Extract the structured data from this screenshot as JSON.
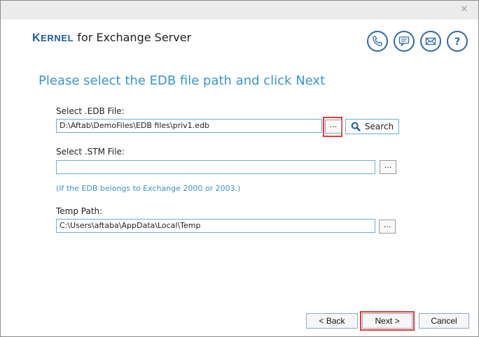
{
  "window": {
    "close_glyph": "✕"
  },
  "brand": {
    "logo_first": "K",
    "logo_rest": "ERNEL",
    "product": " for Exchange Server"
  },
  "header_icons": [
    "phone-icon",
    "chat-icon",
    "mail-icon",
    "help-icon"
  ],
  "heading": "Please select the EDB file path and click Next",
  "edb": {
    "label": "Select .EDB File:",
    "value": "D:\\Aftab\\DemoFiles\\EDB files\\priv1.edb",
    "browse_label": "...",
    "search_label": "Search"
  },
  "stm": {
    "label": "Select .STM File:",
    "value": "",
    "browse_label": "...",
    "note": "(If the EDB belongs to Exchange 2000 or 2003.)"
  },
  "temp": {
    "label": "Temp Path:",
    "value": "C:\\Users\\aftaba\\AppData\\Local\\Temp",
    "browse_label": "..."
  },
  "footer": {
    "back_label": "< Back",
    "next_label": "Next >",
    "cancel_label": "Cancel"
  },
  "colors": {
    "accent": "#3a95c8",
    "brand": "#1b5aa5",
    "highlight": "#e03b3b",
    "field_border": "#6aaed6"
  }
}
